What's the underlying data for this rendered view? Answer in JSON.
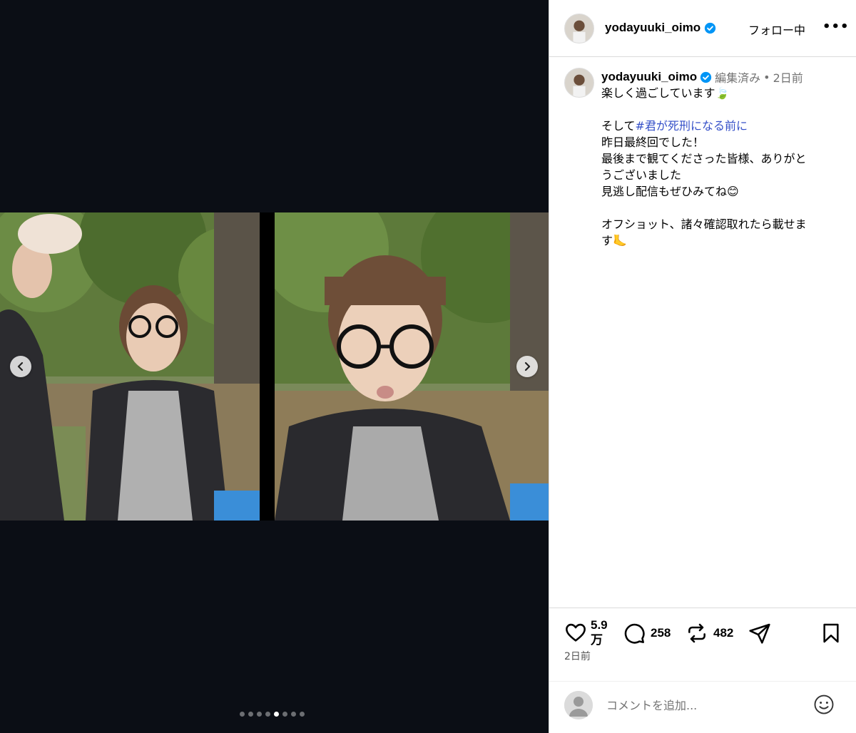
{
  "post": {
    "username": "yodayuuki_oimo",
    "follow_label": "フォロー中",
    "more_label": "•••",
    "edited_label": "編集済み",
    "separator": "•",
    "time_label": "2日前",
    "caption_lines": [
      "楽しく過ごしています🍃",
      "",
      "そして",
      "昨日最終回でした！",
      "最後まで観てくださった皆様、ありがと",
      "うございました",
      "見逃し配信もぜひみてね😊",
      "",
      "オフショット、諸々確認取れたら載せま",
      "す🦶"
    ],
    "caption_hashtag": "#君が死刑になる前に",
    "likes": "5.9",
    "likes_unit": "万",
    "comments": "258",
    "reposts": "482",
    "posted_ago": "2日前",
    "comment_placeholder": "コメントを追加..."
  },
  "carousel": {
    "slide_count": 8,
    "active_index": 4
  },
  "icons": {
    "verified": "verified-badge-icon",
    "like": "heart-icon",
    "comment": "comment-bubble-icon",
    "repost": "repost-icon",
    "share": "send-icon",
    "save": "bookmark-icon",
    "emoji": "emoji-icon",
    "prev": "chevron-left-icon",
    "next": "chevron-right-icon"
  },
  "colors": {
    "media_bg": "#0b0e15",
    "hashtag": "#3550c8",
    "verified": "#0095f6",
    "muted": "#737373"
  }
}
